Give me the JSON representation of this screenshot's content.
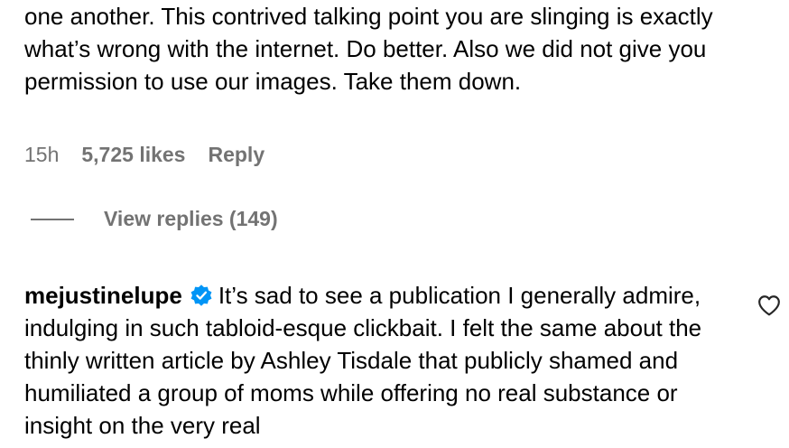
{
  "comment1": {
    "text": "one another. This contrived talking point you are slinging is exactly what’s wrong with the internet. Do better. Also we did not give you permission to use our images. Take them down.",
    "timestamp": "15h",
    "likes": "5,725 likes",
    "reply_label": "Reply"
  },
  "replies": {
    "label": "View replies (149)"
  },
  "comment2": {
    "username": "mejustinelupe",
    "text": "It’s sad to see a publication I generally admire, indulging in such tabloid-esque clickbait. I felt the same about the thinly written article by Ashley Tisdale that publicly shamed and humiliated a group of moms while offering no real substance or insight on the very real",
    "verified_icon": "verified-badge-icon",
    "like_icon": "heart-icon"
  },
  "colors": {
    "verified": "#0095f6",
    "secondary_text": "#737373"
  }
}
